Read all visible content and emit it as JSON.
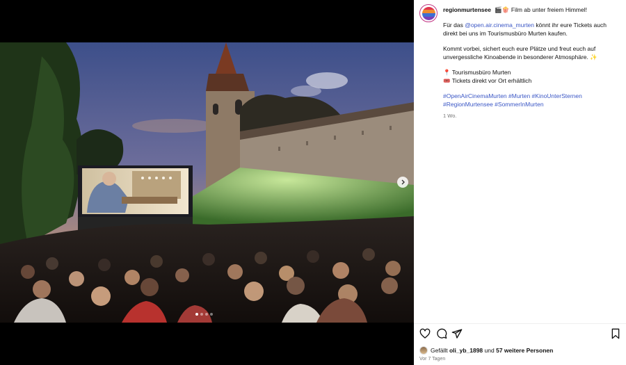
{
  "post": {
    "username": "regionmurtensee",
    "caption_lead": "🎬🍿 Film ab unter freiem Himmel!",
    "p1_before": "Für das ",
    "p1_mention": "@open.air.cinema_murten",
    "p1_after": " könnt ihr eure Tickets auch direkt bei uns im Tourismusbüro Murten kaufen.",
    "p2": "Kommt vorbei, sichert euch eure Plätze und freut euch auf unvergessliche Kinoabende in besonderer Atmosphäre. ✨",
    "p3_line1": "📍 Tourismusbüro Murten",
    "p3_line2": "🎟️ Tickets direkt vor Ort erhältlich",
    "hashtags_line1": "#OpenAirCinemaMurten #Murten #KinoUnterSternen",
    "hashtags_line2": "#RegionMurtensee #SommerInMurten",
    "age": "1 Wo."
  },
  "media": {
    "carousel_count": 4,
    "carousel_active": 0
  },
  "likes": {
    "prefix": "Gefällt",
    "user": "oli_yb_1898",
    "middle": "und",
    "others": "57 weitere Personen"
  },
  "date_label": "Vor 7 Tagen",
  "icons": {
    "like": "heart-icon",
    "comment": "comment-icon",
    "share": "share-icon",
    "save": "bookmark-icon",
    "next": "chevron-right-icon"
  },
  "colors": {
    "link": "#3a56c5",
    "avatar_ring": "#c13584"
  }
}
